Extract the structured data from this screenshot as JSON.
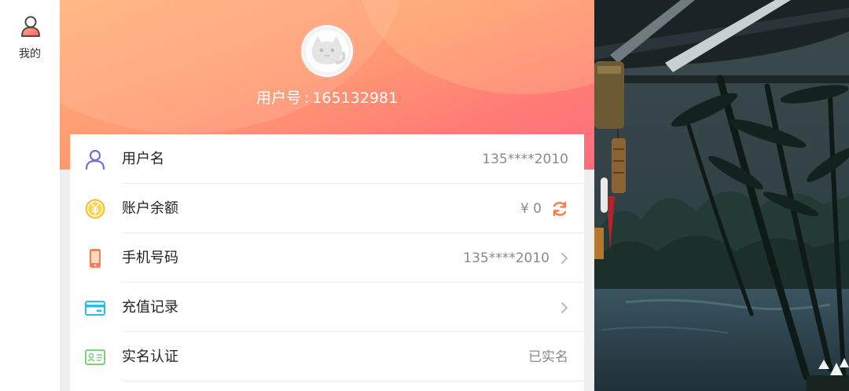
{
  "nav": {
    "items": [
      {
        "label": "我的",
        "icon": "user-icon"
      }
    ]
  },
  "header": {
    "avatar_icon": "cat-avatar-icon",
    "user_id_label": "用户号",
    "user_id_separator": ":",
    "user_id_value": "165132981"
  },
  "account": {
    "rows": [
      {
        "label": "用户名",
        "value": "135****2010",
        "icon": "person-icon",
        "chevron": false
      },
      {
        "label": "账户余额",
        "value": "¥ 0",
        "icon": "yuan-coin-icon",
        "chevron": false,
        "action_icon": "refresh-icon"
      },
      {
        "label": "手机号码",
        "value": "135****2010",
        "icon": "phone-icon",
        "chevron": true
      },
      {
        "label": "充值记录",
        "value": "",
        "icon": "card-icon",
        "chevron": true
      },
      {
        "label": "实名认证",
        "value": "已实名",
        "icon": "id-card-icon",
        "chevron": false
      }
    ]
  },
  "colors": {
    "hero_gradient_start": "#ffb27a",
    "hero_gradient_end": "#ff6b7d",
    "accent_orange": "#ff7a45",
    "person_icon": "#6b73d8",
    "coin": "#f7c32c",
    "phone": "#ff7d4a",
    "card": "#2bbde8",
    "id_card": "#7dcf7a"
  }
}
